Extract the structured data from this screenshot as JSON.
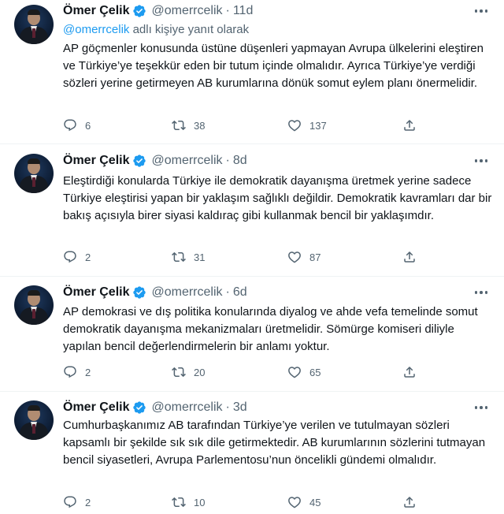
{
  "colors": {
    "accent": "#1d9bf0",
    "secondary_text": "#536471",
    "text": "#0f1419",
    "divider": "#eff3f4"
  },
  "tweets": [
    {
      "name": "Ömer Çelik",
      "handle": "@omerrcelik",
      "separator": "·",
      "time": "11d",
      "reply_mention": "@omerrcelik",
      "reply_suffix": " adlı kişiye yanıt olarak",
      "text": "AP göçmenler konusunda üstüne düşenleri yapmayan Avrupa ülkelerini eleştiren ve Türkiye’ye teşekkür eden bir tutum içinde olmalıdır. Ayrıca Türkiye’ye verdiği sözleri yerine getirmeyen AB kurumlarına dönük somut eylem planı önermelidir.",
      "replies": "6",
      "retweets": "38",
      "likes": "137"
    },
    {
      "name": "Ömer Çelik",
      "handle": "@omerrcelik",
      "separator": "·",
      "time": "8d",
      "text": "Eleştirdiği konularda Türkiye ile demokratik dayanışma üretmek yerine sadece Türkiye eleştirisi yapan bir yaklaşım sağlıklı değildir. Demokratik kavramları dar bir bakış açısıyla birer siyasi kaldıraç gibi kullanmak bencil bir yaklaşımdır.",
      "replies": "2",
      "retweets": "31",
      "likes": "87"
    },
    {
      "name": "Ömer Çelik",
      "handle": "@omerrcelik",
      "separator": "·",
      "time": "6d",
      "text": "AP demokrasi ve dış politika konularında diyalog ve ahde vefa temelinde somut demokratik dayanışma mekanizmaları üretmelidir. Sömürge komiseri diliyle yapılan bencil değerlendirmelerin bir anlamı yoktur.",
      "replies": "2",
      "retweets": "20",
      "likes": "65"
    },
    {
      "name": "Ömer Çelik",
      "handle": "@omerrcelik",
      "separator": "·",
      "time": "3d",
      "text": "Cumhurbaşkanımız AB tarafından Türkiye’ye verilen ve tutulmayan sözleri kapsamlı bir şekilde sık sık dile getirmektedir. AB kurumlarının sözlerini tutmayan bencil siyasetleri, Avrupa Parlementosu’nun öncelikli gündemi olmalıdır.",
      "replies": "2",
      "retweets": "10",
      "likes": "45"
    }
  ]
}
